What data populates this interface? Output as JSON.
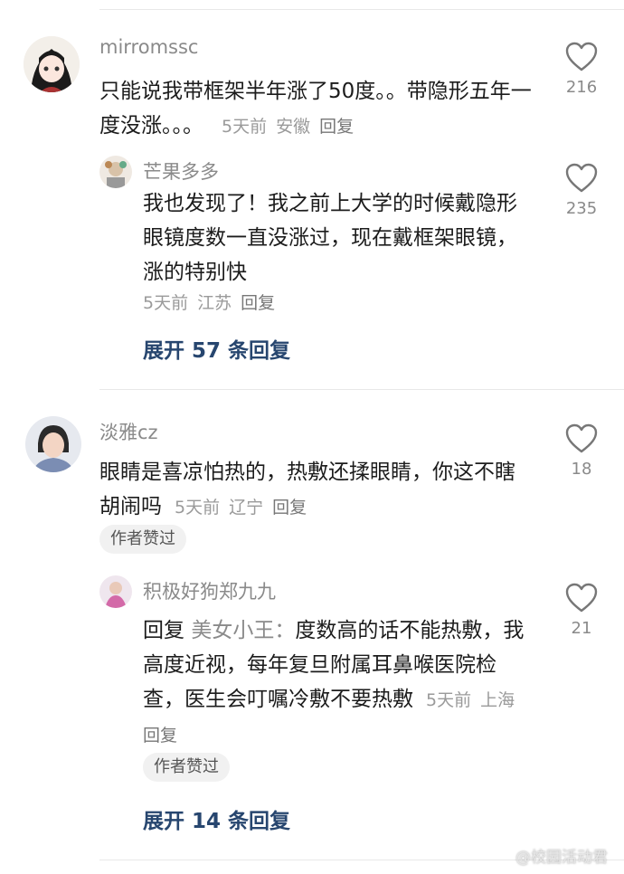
{
  "comments": [
    {
      "user": "mirromssc",
      "text": "只能说我带框架半年涨了50度。。带隐形五年一度没涨。。。",
      "time": "5天前",
      "location": "安徽",
      "reply_label": "回复",
      "likes": "216",
      "reply": {
        "user": "芒果多多",
        "text": "我也发现了！我之前上大学的时候戴隐形眼镜度数一直没涨过，现在戴框架眼镜，涨的特别快",
        "time": "5天前",
        "location": "江苏",
        "reply_label": "回复",
        "likes": "235"
      },
      "expand_label": "展开 57 条回复"
    },
    {
      "user": "淡雅cz",
      "text": "眼睛是喜凉怕热的，热敷还揉眼睛，你这不瞎胡闹吗",
      "time": "5天前",
      "location": "辽宁",
      "reply_label": "回复",
      "likes": "18",
      "author_badge": "作者赞过",
      "reply": {
        "user": "积极好狗郑九九",
        "reply_prefix": "回复",
        "mention": "美女小王：",
        "text": "度数高的话不能热敷，我高度近视，每年复旦附属耳鼻喉医院检查，医生会叮嘱冷敷不要热敷",
        "time": "5天前",
        "location": "上海",
        "reply_label": "回复",
        "likes": "21",
        "author_badge": "作者赞过"
      },
      "expand_label": "展开 14 条回复"
    }
  ],
  "watermark": "@校园活动君"
}
